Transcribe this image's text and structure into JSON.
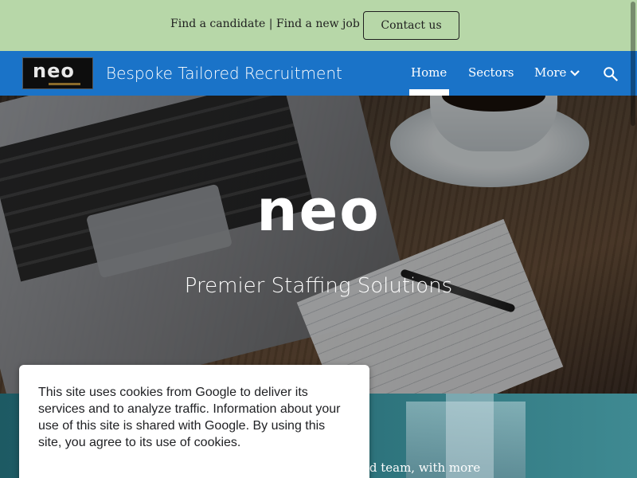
{
  "topbar": {
    "find_candidate": "Find a candidate",
    "separator": "|",
    "find_job": "Find a new job",
    "contact_label": "Contact us"
  },
  "navbar": {
    "logo_text": "neo",
    "site_title": "Bespoke Tailored Recruitment",
    "items": [
      {
        "label": "Home",
        "active": true
      },
      {
        "label": "Sectors",
        "active": false
      },
      {
        "label": "More",
        "active": false
      }
    ],
    "icons": {
      "more": "chevron-down-icon",
      "search": "search-icon"
    },
    "background_color": "#1a73c8"
  },
  "hero": {
    "logo_text": "neo",
    "subtitle": "Premier Staffing Solutions"
  },
  "lower": {
    "partial_text": "ated team, with more"
  },
  "cookie_banner": {
    "text": "This site uses cookies from Google to deliver its services and to analyze traffic. Information about your use of this site is shared with Google. By using this site, you agree to its use of cookies."
  },
  "colors": {
    "topbar_bg": "#b7d7a8",
    "nav_bg": "#1a73c8"
  }
}
